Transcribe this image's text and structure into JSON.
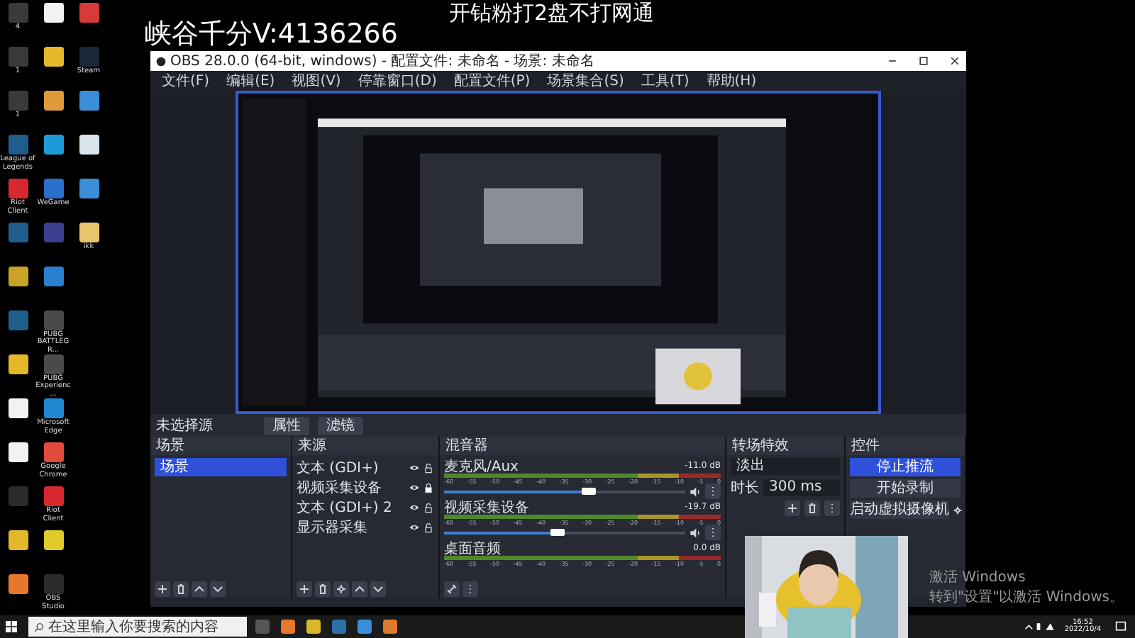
{
  "overlay_texts": [
    "峡谷千分V:4136266",
    "开钻粉打2盘不打网通"
  ],
  "desktop_icons": [
    {
      "label": "4",
      "color": "#3a3a3a"
    },
    {
      "label": "1",
      "color": "#3a3a3a"
    },
    {
      "label": "1",
      "color": "#3a3a3a"
    },
    {
      "label": "League of Legends",
      "color": "#1f5d8c"
    },
    {
      "label": "Riot Client",
      "color": "#d7282f"
    },
    {
      "color": "#1f5d8c"
    },
    {
      "color": "#c9a227"
    },
    {
      "color": "#1f5d8c"
    },
    {
      "color": "#e5b72a"
    },
    {
      "color": "#f2f2f2"
    },
    {
      "color": "#f2f2f2"
    },
    {
      "color": "#2b2b2b"
    },
    {
      "color": "#e5b72a"
    },
    {
      "color": "#e8772e"
    },
    {
      "color": "#f2f2f2"
    },
    {
      "color": "#e5b72a"
    },
    {
      "color": "#e09a3b"
    },
    {
      "color": "#1c9bd6"
    },
    {
      "label": "WeGame",
      "color": "#2a6fc9"
    },
    {
      "color": "#3a3f8f"
    },
    {
      "color": "#2a7fd0"
    },
    {
      "label": "PUBG BATTLEGR...",
      "color": "#4a4a4a"
    },
    {
      "label": "PUBG Experienc...",
      "color": "#4a4a4a"
    },
    {
      "label": "Microsoft Edge",
      "color": "#1f8ad2"
    },
    {
      "label": "Google Chrome",
      "color": "#e24a3b"
    },
    {
      "label": "Riot Client",
      "color": "#d7282f"
    },
    {
      "color": "#e0c92a"
    },
    {
      "label": "OBS Studio",
      "color": "#2b2b2b"
    },
    {
      "color": "#d83a3a"
    },
    {
      "label": "Steam",
      "color": "#1b2838"
    },
    {
      "color": "#3a8ed8"
    },
    {
      "color": "#d8e4ee"
    },
    {
      "color": "#3a8ed8"
    },
    {
      "label": "ikk",
      "color": "#e8c56c"
    }
  ],
  "obs": {
    "title": "OBS 28.0.0 (64-bit, windows) - 配置文件: 未命名 - 场景: 未命名",
    "menu": [
      "文件(F)",
      "编辑(E)",
      "视图(V)",
      "停靠窗口(D)",
      "配置文件(P)",
      "场景集合(S)",
      "工具(T)",
      "帮助(H)"
    ],
    "source_toolbar": {
      "label": "未选择源",
      "buttons": [
        "属性",
        "滤镜"
      ]
    },
    "scenes": {
      "title": "场景",
      "items": [
        {
          "label": "场景",
          "selected": true
        }
      ]
    },
    "sources": {
      "title": "来源",
      "items": [
        {
          "label": "文本 (GDI+)",
          "locked": false
        },
        {
          "label": "视频采集设备",
          "locked": true
        },
        {
          "label": "文本 (GDI+) 2",
          "locked": false
        },
        {
          "label": "显示器采集",
          "locked": false
        }
      ]
    },
    "mixer": {
      "title": "混音器",
      "channels": [
        {
          "name": "麦克风/Aux",
          "reading": "-11.0 dB",
          "level": 0.6,
          "scale": [
            "-60",
            "-55",
            "-50",
            "-45",
            "-40",
            "-35",
            "-30",
            "-25",
            "-20",
            "-15",
            "-10",
            "-5",
            "0"
          ]
        },
        {
          "name": "视频采集设备",
          "reading": "-19.7 dB",
          "level": 0.47,
          "scale": [
            "-60",
            "-55",
            "-50",
            "-45",
            "-40",
            "-35",
            "-30",
            "-25",
            "-20",
            "-15",
            "-10",
            "-5",
            "0"
          ]
        },
        {
          "name": "桌面音频",
          "reading": "0.0 dB",
          "scale": [
            "-60",
            "-55",
            "-50",
            "-45",
            "-40",
            "-35",
            "-30",
            "-25",
            "-20",
            "-15",
            "-10",
            "-5",
            "0"
          ]
        }
      ]
    },
    "transitions": {
      "title": "转场特效",
      "selected": "淡出",
      "duration_label": "时长",
      "duration": "300 ms"
    },
    "controls": {
      "title": "控件",
      "buttons": [
        {
          "label": "停止推流",
          "primary": true
        },
        {
          "label": "开始录制",
          "primary": false
        },
        {
          "label": "启动虚拟摄像机",
          "primary": false
        }
      ]
    }
  },
  "taskbar": {
    "search_placeholder": "在这里输入你要搜索的内容",
    "apps": [
      {
        "color": "#555555"
      },
      {
        "color": "#e8772e"
      },
      {
        "color": "#d9b72a"
      },
      {
        "color": "#2f6fa8"
      },
      {
        "color": "#3a8ed8"
      },
      {
        "color": "#e07a2e"
      }
    ],
    "time": "16:52",
    "date": "2022/10/4"
  },
  "activation": [
    "激活 Windows",
    "转到\"设置\"以激活 Windows。"
  ]
}
